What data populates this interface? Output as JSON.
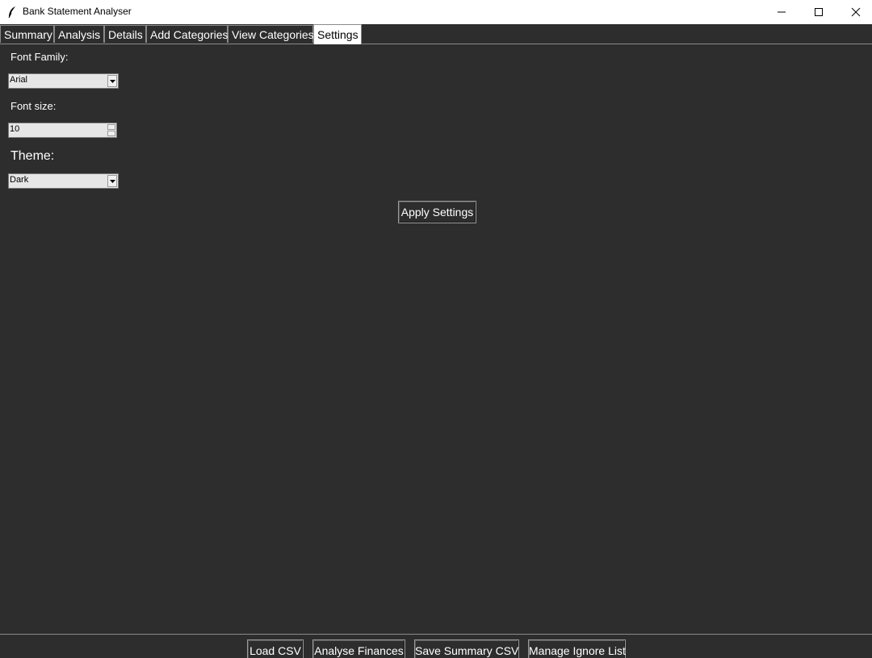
{
  "window": {
    "title": "Bank Statement Analyser",
    "icon": "feather-icon",
    "controls": [
      "minimize-icon",
      "maximize-icon",
      "close-icon"
    ]
  },
  "tabs": [
    {
      "label": "Summary"
    },
    {
      "label": "Analysis"
    },
    {
      "label": "Details"
    },
    {
      "label": "Add Categories"
    },
    {
      "label": "View Categories"
    },
    {
      "label": "Settings"
    }
  ],
  "active_tab": "Settings",
  "settings": {
    "font_family_label": "Font Family:",
    "font_family_value": "Arial",
    "font_size_label": "Font size:",
    "font_size_value": "10",
    "theme_label": "Theme:",
    "theme_value": "Dark",
    "apply_label": "Apply Settings"
  },
  "bottom_buttons": [
    {
      "label": "Load CSV"
    },
    {
      "label": "Analyse Finances"
    },
    {
      "label": "Save Summary CSV"
    },
    {
      "label": "Manage Ignore List"
    }
  ],
  "colors": {
    "background": "#2d2d2d",
    "text": "#ffffff",
    "titlebar": "#ffffff"
  }
}
